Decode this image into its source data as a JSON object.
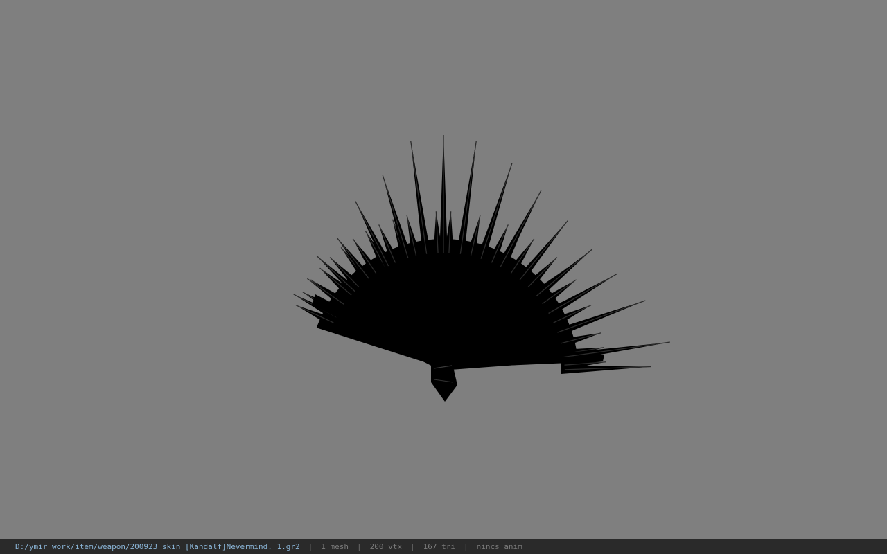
{
  "viewport": {
    "background": "#7f7f7f",
    "model_color": "#000000",
    "model_label": "spiked-fan-weapon-model"
  },
  "status_bar": {
    "file_path": "D:/ymir work/item/weapon/200923_skin_[Kandalf]Nevermind._1.gr2",
    "separator": "|",
    "mesh_count": "1 mesh",
    "vertex_count": "200 vtx",
    "triangle_count": "167 tri",
    "anim_status": "nincs anim"
  }
}
